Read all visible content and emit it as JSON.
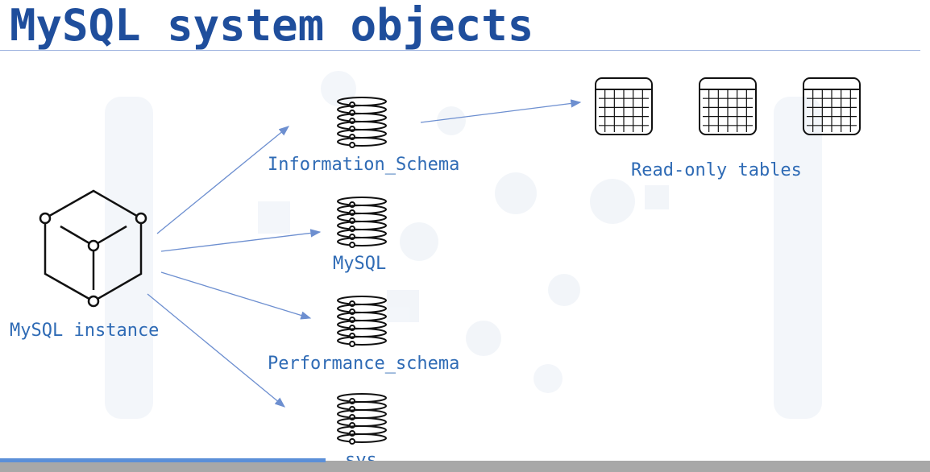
{
  "title": "MySQL system objects",
  "instance": {
    "label": "MySQL instance"
  },
  "databases": [
    {
      "label": "Information_Schema"
    },
    {
      "label": "MySQL"
    },
    {
      "label": "Performance_schema"
    },
    {
      "label": "sys"
    }
  ],
  "tables": {
    "label": "Read-only tables",
    "count": 3
  },
  "colors": {
    "title": "#1f4e9c",
    "label": "#2f6bb5",
    "arrow": "#6d8fd0",
    "icon": "#111111"
  },
  "player": {
    "progress": 0.35
  }
}
